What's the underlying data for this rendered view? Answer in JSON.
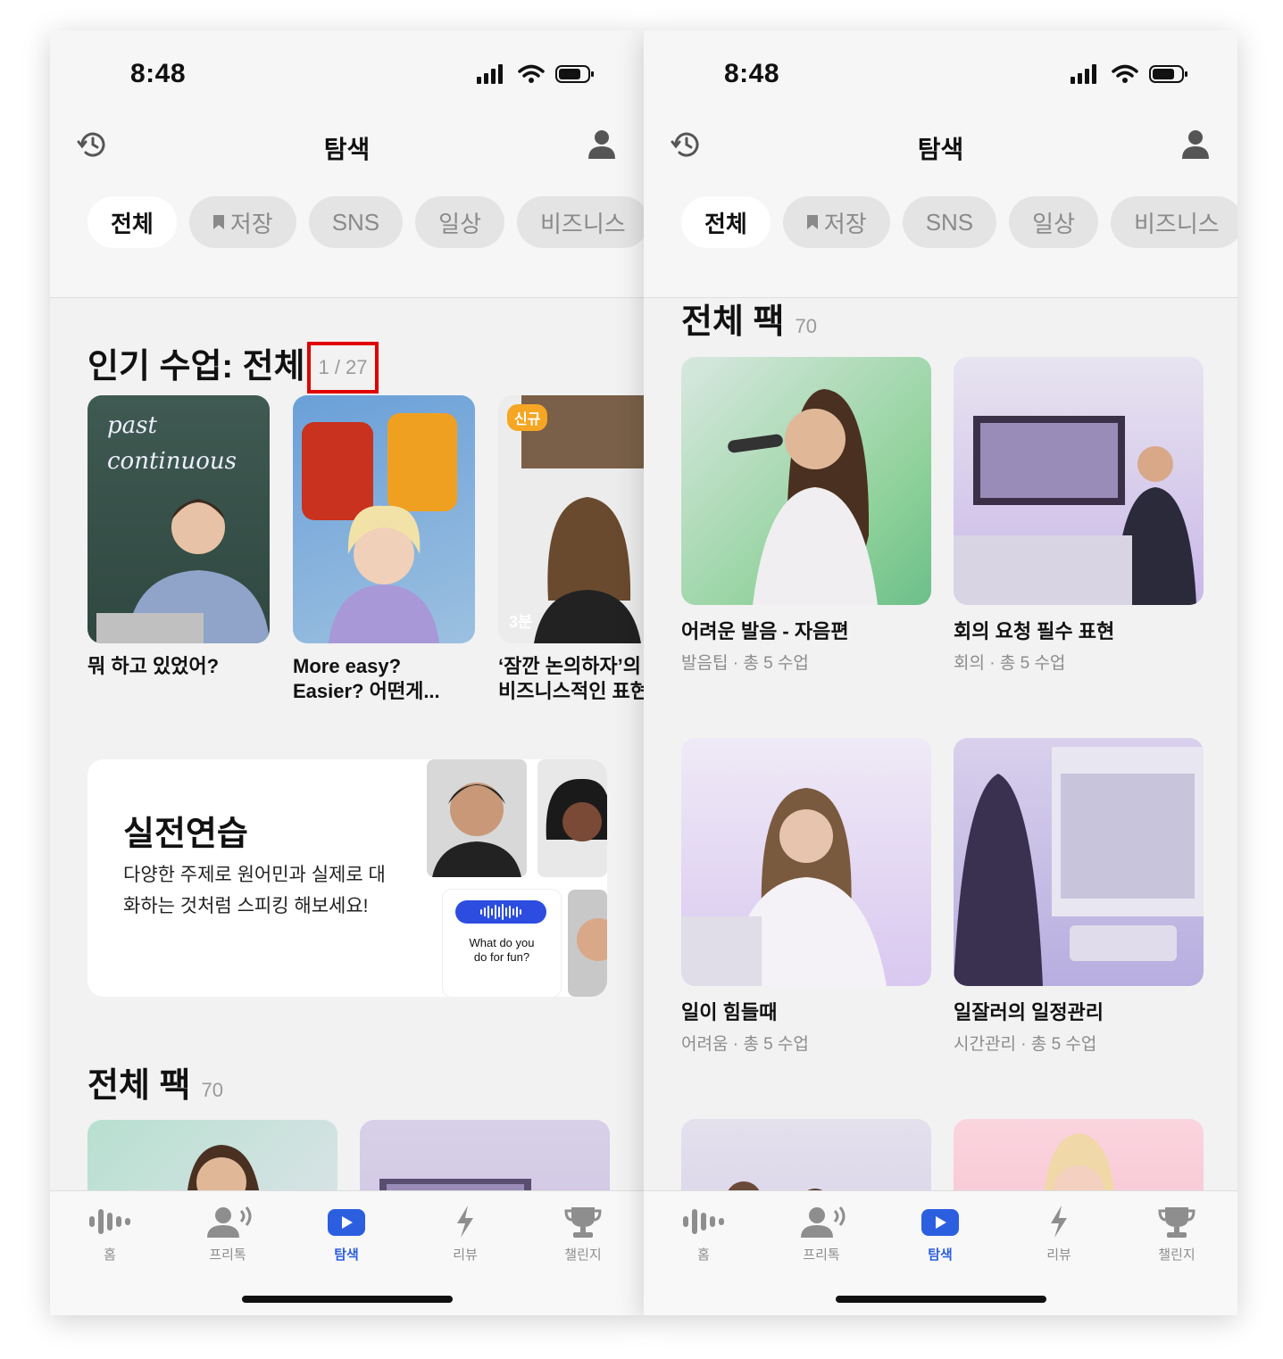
{
  "status": {
    "time": "8:48"
  },
  "header": {
    "title": "탐색"
  },
  "chips": [
    {
      "label": "전체",
      "active": true
    },
    {
      "label": "저장",
      "icon": "bookmark-icon"
    },
    {
      "label": "SNS"
    },
    {
      "label": "일상"
    },
    {
      "label": "비즈니스"
    }
  ],
  "popular": {
    "title": "인기 수업: 전체",
    "counter": "1 / 27",
    "lessons": [
      {
        "title": "뭐 하고 있었어?",
        "chalk": "past\ncontinuous"
      },
      {
        "title": "More easy?\nEasier? 어떤게...",
        "badge": ""
      },
      {
        "title": "‘잠깐 논의하자’의\n비즈니스적인 표현",
        "badge": "신규",
        "duration": "3분"
      }
    ]
  },
  "practice": {
    "title": "실전연습",
    "description": "다양한 주제로 원어민과 실제로 대화하는 것처럼 스피킹 해보세요!",
    "bubble_text": "What do you\ndo for fun?"
  },
  "packs": {
    "title": "전체 팩",
    "count": "70",
    "items": [
      {
        "title": "어려운 발음 - 자음편",
        "meta": "발음팁 · 총 5 수업",
        "color": "#8fd19a"
      },
      {
        "title": "회의 요청 필수 표현",
        "meta": "회의 · 총 5 수업",
        "color": "#c9b8e8"
      },
      {
        "title": "일이 힘들때",
        "meta": "어려움 · 총 5 수업",
        "color": "#d9c8f0"
      },
      {
        "title": "일잘러의 일정관리",
        "meta": "시간관리 · 총 5 수업",
        "color": "#b8aee0"
      },
      {
        "title": "",
        "meta": "",
        "color": "#cfc8e8"
      },
      {
        "title": "",
        "meta": "",
        "color": "#f5b8c8"
      }
    ]
  },
  "tabs": [
    {
      "label": "홈",
      "icon": "waveform-icon"
    },
    {
      "label": "프리톡",
      "icon": "speaking-person-icon"
    },
    {
      "label": "탐색",
      "icon": "play-icon",
      "active": true
    },
    {
      "label": "리뷰",
      "icon": "lightning-icon"
    },
    {
      "label": "챌린지",
      "icon": "trophy-icon"
    }
  ],
  "colors": {
    "accent": "#2c5fe0",
    "highlight": "#e00000",
    "badge": "#f5a623"
  }
}
